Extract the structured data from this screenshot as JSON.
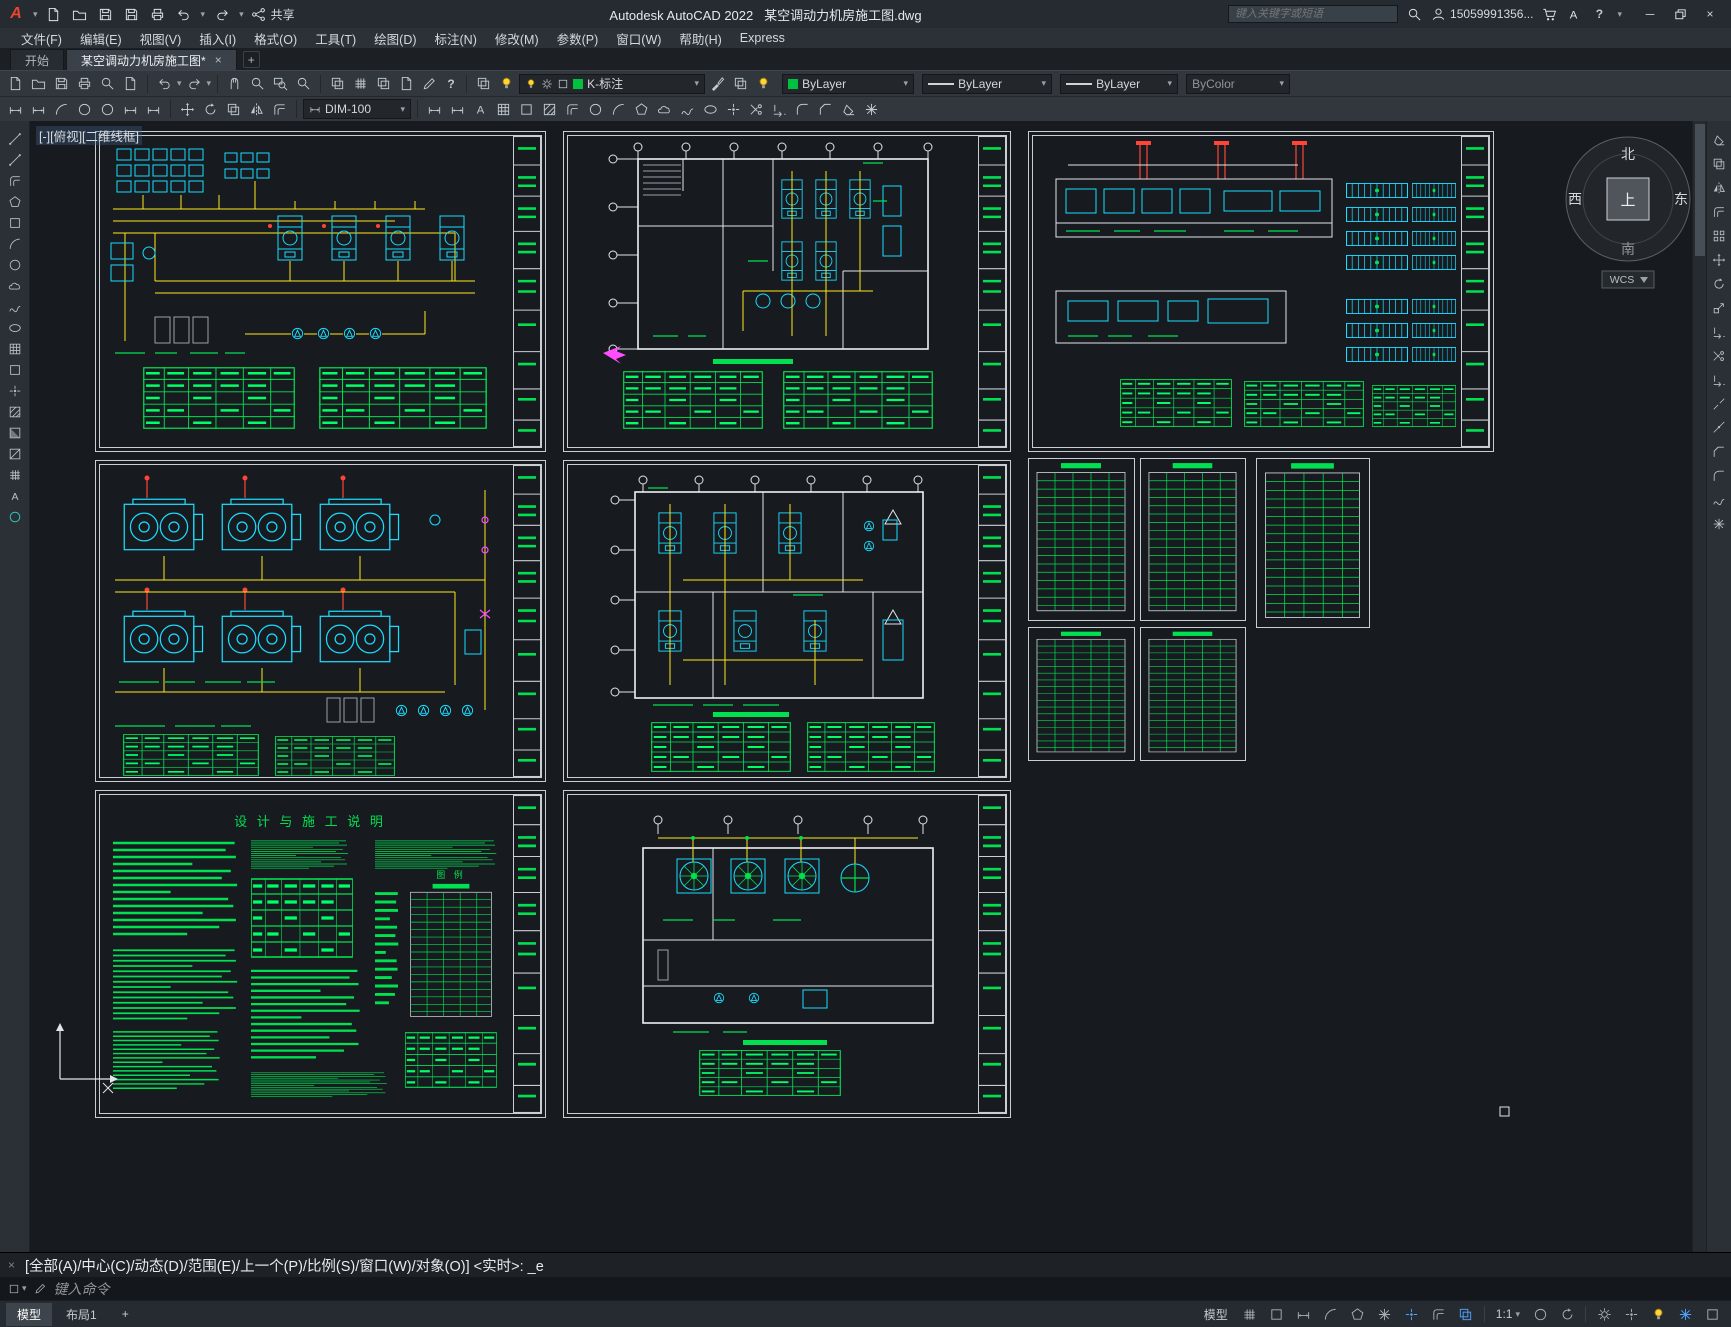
{
  "titlebar": {
    "logo": "A",
    "app_title": "Autodesk AutoCAD 2022",
    "doc_title": "某空调动力机房施工图.dwg",
    "share_label": "共享",
    "search_placeholder": "键入关键字或短语",
    "account": "15059991356...",
    "help_label": "?",
    "window_buttons": {
      "minimize": "─",
      "close": "×"
    }
  },
  "menubar": {
    "items": [
      "文件(F)",
      "编辑(E)",
      "视图(V)",
      "插入(I)",
      "格式(O)",
      "工具(T)",
      "绘图(D)",
      "标注(N)",
      "修改(M)",
      "参数(P)",
      "窗口(W)",
      "帮助(H)",
      "Express"
    ]
  },
  "filetabs": {
    "start_tab": "开始",
    "active_tab": "某空调动力机房施工图*",
    "close": "×",
    "new_tab": "+"
  },
  "toolbar": {
    "layer_combo": "K-标注",
    "color_combo": "ByLayer",
    "linetype_combo": "ByLayer",
    "lineweight_combo": "ByLayer",
    "plotstyle_combo": "ByColor",
    "dimstyle_combo": "DIM-100"
  },
  "canvas": {
    "viewport_label": "[-][俯视][二维线框]",
    "viewcube": {
      "north": "北",
      "south": "南",
      "east": "东",
      "west": "西",
      "top": "上",
      "wcs": "WCS"
    },
    "sheet_notes": {
      "title": "设 计 与 施 工 说 明",
      "legend_title": "图 例"
    }
  },
  "command": {
    "history_line": "[全部(A)/中心(C)/动态(D)/范围(E)/上一个(P)/比例(S)/窗口(W)/对象(O)] <实时>: _e",
    "input_placeholder": "键入命令"
  },
  "statusbar": {
    "model_tab": "模型",
    "layout_tab": "布局1",
    "new_layout": "+",
    "model_space_label": "模型",
    "annotation_scale": "1:1"
  },
  "colors": {
    "cad_green": "#00e050",
    "cad_cyan": "#19dcff",
    "cad_yellow": "#ffe81a",
    "cad_red": "#ff4438",
    "cad_magenta": "#ff4dff",
    "accent_blue": "#4da3ff"
  }
}
